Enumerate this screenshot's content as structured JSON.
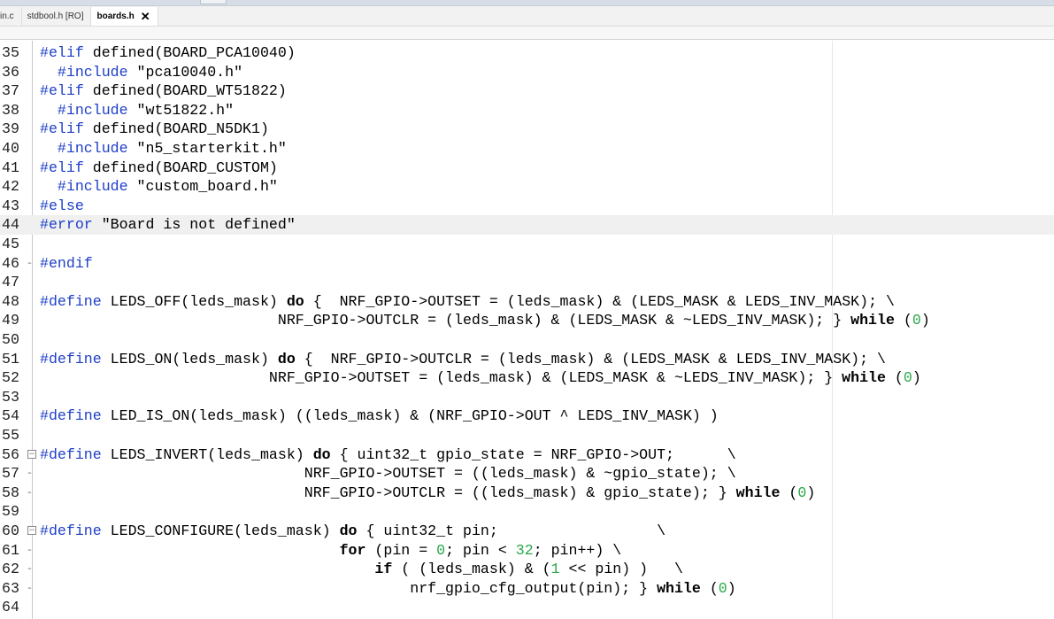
{
  "tabs": [
    {
      "label": "in.c",
      "active": false
    },
    {
      "label": "stdbool.h [RO]",
      "active": false
    },
    {
      "label": "boards.h",
      "active": true,
      "close": "✕"
    }
  ],
  "lines": [
    {
      "n": "35",
      "segs": [
        [
          "pp",
          "#elif"
        ],
        [
          "",
          " defined(BOARD_PCA10040)"
        ]
      ]
    },
    {
      "n": "36",
      "segs": [
        [
          "",
          "  "
        ],
        [
          "pp",
          "#include"
        ],
        [
          "",
          " \"pca10040.h\""
        ]
      ]
    },
    {
      "n": "37",
      "segs": [
        [
          "pp",
          "#elif"
        ],
        [
          "",
          " defined(BOARD_WT51822)"
        ]
      ]
    },
    {
      "n": "38",
      "segs": [
        [
          "",
          "  "
        ],
        [
          "pp",
          "#include"
        ],
        [
          "",
          " \"wt51822.h\""
        ]
      ]
    },
    {
      "n": "39",
      "segs": [
        [
          "pp",
          "#elif"
        ],
        [
          "",
          " defined(BOARD_N5DK1)"
        ]
      ]
    },
    {
      "n": "40",
      "segs": [
        [
          "",
          "  "
        ],
        [
          "pp",
          "#include"
        ],
        [
          "",
          " \"n5_starterkit.h\""
        ]
      ]
    },
    {
      "n": "41",
      "segs": [
        [
          "pp",
          "#elif"
        ],
        [
          "",
          " defined(BOARD_CUSTOM)"
        ]
      ]
    },
    {
      "n": "42",
      "segs": [
        [
          "",
          "  "
        ],
        [
          "pp",
          "#include"
        ],
        [
          "",
          " \"custom_board.h\""
        ]
      ]
    },
    {
      "n": "43",
      "segs": [
        [
          "pp",
          "#else"
        ]
      ]
    },
    {
      "n": "44",
      "segs": [
        [
          "pp",
          "#error"
        ],
        [
          "",
          " \"Board is not defined\""
        ]
      ],
      "highlight": true
    },
    {
      "n": "45",
      "segs": []
    },
    {
      "n": "46",
      "segs": [
        [
          "pp",
          "#endif"
        ]
      ],
      "fold": "-"
    },
    {
      "n": "47",
      "segs": []
    },
    {
      "n": "48",
      "segs": [
        [
          "pp",
          "#define"
        ],
        [
          "",
          " LEDS_OFF(leds_mask) "
        ],
        [
          "kw",
          "do"
        ],
        [
          "",
          " {  NRF_GPIO->OUTSET = (leds_mask) & (LEDS_MASK & LEDS_INV_MASK); \\"
        ]
      ]
    },
    {
      "n": "49",
      "segs": [
        [
          "",
          "                           NRF_GPIO->OUTCLR = (leds_mask) & (LEDS_MASK & ~LEDS_INV_MASK); } "
        ],
        [
          "kw",
          "while"
        ],
        [
          "",
          " ("
        ],
        [
          "num",
          "0"
        ],
        [
          "",
          ")"
        ]
      ]
    },
    {
      "n": "50",
      "segs": []
    },
    {
      "n": "51",
      "segs": [
        [
          "pp",
          "#define"
        ],
        [
          "",
          " LEDS_ON(leds_mask) "
        ],
        [
          "kw",
          "do"
        ],
        [
          "",
          " {  NRF_GPIO->OUTCLR = (leds_mask) & (LEDS_MASK & LEDS_INV_MASK); \\"
        ]
      ]
    },
    {
      "n": "52",
      "segs": [
        [
          "",
          "                          NRF_GPIO->OUTSET = (leds_mask) & (LEDS_MASK & ~LEDS_INV_MASK); } "
        ],
        [
          "kw",
          "while"
        ],
        [
          "",
          " ("
        ],
        [
          "num",
          "0"
        ],
        [
          "",
          ")"
        ]
      ]
    },
    {
      "n": "53",
      "segs": []
    },
    {
      "n": "54",
      "segs": [
        [
          "pp",
          "#define"
        ],
        [
          "",
          " LED_IS_ON(leds_mask) ((leds_mask) & (NRF_GPIO->OUT ^ LEDS_INV_MASK) )"
        ]
      ]
    },
    {
      "n": "55",
      "segs": []
    },
    {
      "n": "56",
      "segs": [
        [
          "pp",
          "#define"
        ],
        [
          "",
          " LEDS_INVERT(leds_mask) "
        ],
        [
          "kw",
          "do"
        ],
        [
          "",
          " { uint32_t gpio_state = NRF_GPIO->OUT;      \\"
        ]
      ],
      "fold": "box"
    },
    {
      "n": "57",
      "segs": [
        [
          "",
          "                              NRF_GPIO->OUTSET = ((leds_mask) & ~gpio_state); \\"
        ]
      ],
      "fold": "-"
    },
    {
      "n": "58",
      "segs": [
        [
          "",
          "                              NRF_GPIO->OUTCLR = ((leds_mask) & gpio_state); } "
        ],
        [
          "kw",
          "while"
        ],
        [
          "",
          " ("
        ],
        [
          "num",
          "0"
        ],
        [
          "",
          ")"
        ]
      ],
      "fold": "-"
    },
    {
      "n": "59",
      "segs": []
    },
    {
      "n": "60",
      "segs": [
        [
          "pp",
          "#define"
        ],
        [
          "",
          " LEDS_CONFIGURE(leds_mask) "
        ],
        [
          "kw",
          "do"
        ],
        [
          "",
          " { uint32_t pin;                  \\"
        ]
      ],
      "fold": "box"
    },
    {
      "n": "61",
      "segs": [
        [
          "",
          "                                  "
        ],
        [
          "kw",
          "for"
        ],
        [
          "",
          " (pin = "
        ],
        [
          "num",
          "0"
        ],
        [
          "",
          "; pin < "
        ],
        [
          "num",
          "32"
        ],
        [
          "",
          "; pin++) \\"
        ]
      ],
      "fold": "-"
    },
    {
      "n": "62",
      "segs": [
        [
          "",
          "                                      "
        ],
        [
          "kw",
          "if"
        ],
        [
          "",
          " ( (leds_mask) & ("
        ],
        [
          "num",
          "1"
        ],
        [
          "",
          " << pin) )   \\"
        ]
      ],
      "fold": "-"
    },
    {
      "n": "63",
      "segs": [
        [
          "",
          "                                          nrf_gpio_cfg_output(pin); } "
        ],
        [
          "kw",
          "while"
        ],
        [
          "",
          " ("
        ],
        [
          "num",
          "0"
        ],
        [
          "",
          ")"
        ]
      ],
      "fold": "-"
    },
    {
      "n": "64",
      "segs": []
    }
  ]
}
